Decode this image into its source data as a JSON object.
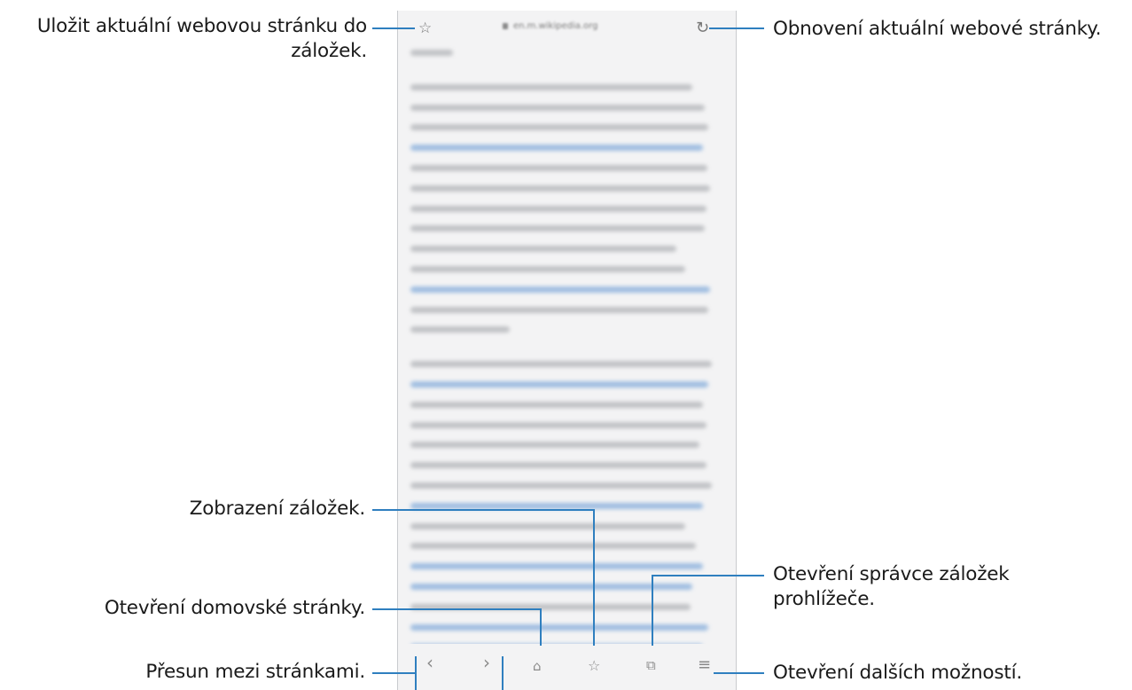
{
  "annotations": {
    "save_bookmark": "Uložit aktuální webovou stránku do záložek.",
    "refresh": "Obnovení aktuální webové stránky.",
    "view_bookmarks": "Zobrazení záložek.",
    "tab_manager": "Otevření správce záložek prohlížeče.",
    "home": "Otevření domovské stránky.",
    "navigate": "Přesun mezi stránkami.",
    "more_options": "Otevření dalších možností."
  },
  "browser": {
    "url": "en.m.wikipedia.org",
    "icons": {
      "bookmark_star": "star-outline-icon",
      "refresh": "refresh-icon",
      "back": "chevron-left-icon",
      "forward": "chevron-right-icon",
      "home": "home-icon",
      "bookmarks": "star-list-icon",
      "tabs": "tabs-icon",
      "menu": "hamburger-menu-icon"
    }
  },
  "colors": {
    "callout_line": "#2f7fbf",
    "screen_bg": "#f3f3f4"
  }
}
